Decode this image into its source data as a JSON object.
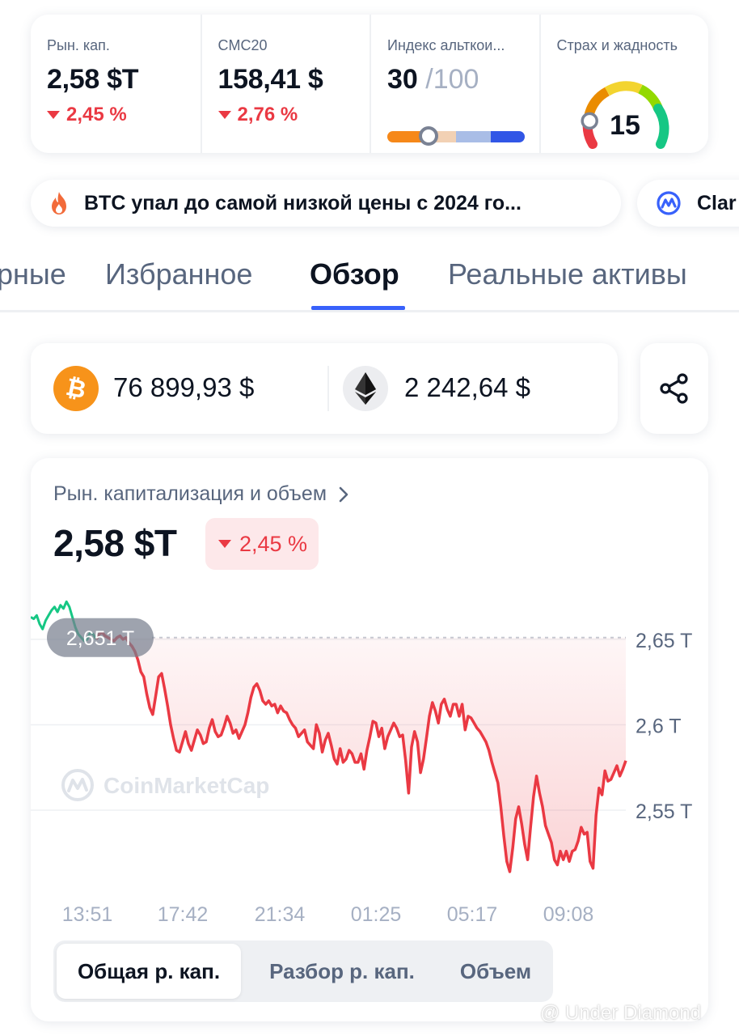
{
  "stats": {
    "market_cap": {
      "label": "Рын. кап.",
      "value": "2,58 $T",
      "change": "2,45 %"
    },
    "cmc20": {
      "label": "CMC20",
      "value": "158,41 $",
      "change": "2,76 %"
    },
    "altcoin_index": {
      "label": "Индекс альткои...",
      "value": "30",
      "max": "/100",
      "level": 0.3
    },
    "fear_greed": {
      "label": "Страх и жадность",
      "value": "15",
      "level": 0.15
    }
  },
  "news": [
    {
      "text": "BTC упал до самой низкой цены с 2024 го...",
      "icon": "fire-icon"
    },
    {
      "text": "Clar",
      "icon": "coinmarketcap-icon"
    }
  ],
  "tabs": [
    "рные",
    "Избранное",
    "Обзор",
    "Реальные активы"
  ],
  "active_tab": "Обзор",
  "prices": {
    "btc": {
      "price": "76 899,93 $",
      "color": "#16c784",
      "icon": "bitcoin-icon"
    },
    "eth": {
      "price": "2 242,64 $",
      "icon": "ethereum-icon"
    }
  },
  "chart_card": {
    "title": "Рын. капитализация и объем",
    "value": "2,58 $T",
    "change": "2,45 %",
    "watermark": "CoinMarketCap",
    "reference_label": "2,651 T"
  },
  "chart_data": {
    "type": "line",
    "title": "Рын. капитализация и объем",
    "y_tick_labels": [
      "2,65 T",
      "2,6 T",
      "2,55 T"
    ],
    "y_ticks": [
      2.65,
      2.6,
      2.55
    ],
    "ylim": [
      2.505,
      2.685
    ],
    "x_tick_labels": [
      "13:51",
      "17:42",
      "21:34",
      "01:25",
      "05:17",
      "09:08"
    ],
    "reference_value": 2.651,
    "series": [
      {
        "values": [
          2.663,
          2.662,
          2.664,
          2.659,
          2.656,
          2.661,
          2.664,
          2.667,
          2.669,
          2.666,
          2.67,
          2.668,
          2.672,
          2.669,
          2.663,
          2.657,
          2.653,
          2.651,
          2.649,
          2.65,
          2.654,
          2.653,
          2.65,
          2.653,
          2.654,
          2.652,
          2.651,
          2.65,
          2.649,
          2.651,
          2.652,
          2.65,
          2.651,
          2.648,
          2.646,
          2.643,
          2.638,
          2.631,
          2.628,
          2.618,
          2.61,
          2.606,
          2.617,
          2.628,
          2.63,
          2.621,
          2.611,
          2.6,
          2.592,
          2.585,
          2.584,
          2.59,
          2.596,
          2.589,
          2.585,
          2.591,
          2.597,
          2.594,
          2.589,
          2.59,
          2.598,
          2.603,
          2.596,
          2.593,
          2.594,
          2.599,
          2.605,
          2.601,
          2.595,
          2.597,
          2.592,
          2.596,
          2.6,
          2.607,
          2.616,
          2.622,
          2.624,
          2.62,
          2.614,
          2.612,
          2.614,
          2.611,
          2.612,
          2.607,
          2.611,
          2.608,
          2.607,
          2.603,
          2.6,
          2.598,
          2.593,
          2.595,
          2.597,
          2.59,
          2.588,
          2.586,
          2.6,
          2.595,
          2.584,
          2.591,
          2.595,
          2.588,
          2.58,
          2.577,
          2.586,
          2.578,
          2.58,
          2.585,
          2.583,
          2.578,
          2.578,
          2.583,
          2.574,
          2.585,
          2.593,
          2.602,
          2.601,
          2.593,
          2.598,
          2.586,
          2.593,
          2.597,
          2.601,
          2.598,
          2.593,
          2.594,
          2.579,
          2.56,
          2.587,
          2.596,
          2.59,
          2.572,
          2.58,
          2.592,
          2.605,
          2.613,
          2.608,
          2.601,
          2.612,
          2.615,
          2.609,
          2.605,
          2.612,
          2.612,
          2.605,
          2.612,
          2.597,
          2.605,
          2.604,
          2.601,
          2.598,
          2.596,
          2.593,
          2.59,
          2.585,
          2.578,
          2.572,
          2.566,
          2.552,
          2.535,
          2.52,
          2.514,
          2.528,
          2.545,
          2.552,
          2.542,
          2.53,
          2.521,
          2.54,
          2.558,
          2.57,
          2.56,
          2.552,
          2.541,
          2.536,
          2.531,
          2.521,
          2.518,
          2.526,
          2.521,
          2.526,
          2.52,
          2.526,
          2.527,
          2.532,
          2.54,
          2.536,
          2.537,
          2.52,
          2.516,
          2.547,
          2.563,
          2.559,
          2.573,
          2.567,
          2.568,
          2.572,
          2.576,
          2.57,
          2.574,
          2.579
        ]
      }
    ],
    "grid": true,
    "line_color": "#ea3943",
    "up_color": "#16c784"
  },
  "segments": [
    "Общая р. кап.",
    "Разбор р. кап.",
    "Объем"
  ],
  "active_segment": "Общая р. кап.",
  "watermark_text": "@ Under Diamond"
}
